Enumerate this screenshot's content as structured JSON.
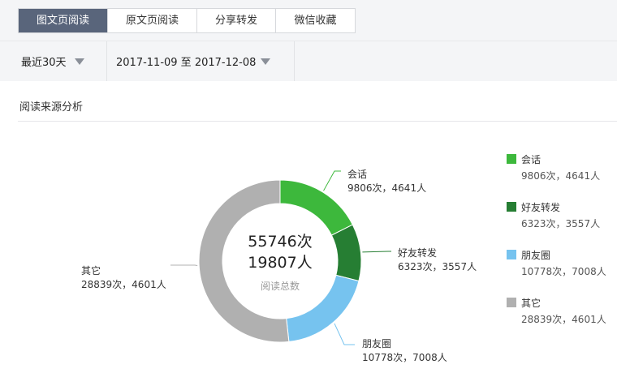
{
  "tabs": [
    {
      "label": "图文页阅读",
      "active": true
    },
    {
      "label": "原文页阅读",
      "active": false
    },
    {
      "label": "分享转发",
      "active": false
    },
    {
      "label": "微信收藏",
      "active": false
    }
  ],
  "filters": {
    "range_label": "最近30天",
    "date_range": "2017-11-09 至 2017-12-08"
  },
  "section": {
    "title": "阅读来源分析"
  },
  "chart_data": {
    "type": "pie",
    "variant": "donut",
    "legend_placement": "right",
    "center": {
      "total_times": "55746次",
      "total_people": "19807人",
      "caption": "阅读总数"
    },
    "slices": [
      {
        "name": "会话",
        "times": 9806,
        "people": 4641,
        "label": "9806次，4641人",
        "color": "#3db83c"
      },
      {
        "name": "好友转发",
        "times": 6323,
        "people": 3557,
        "label": "6323次，3557人",
        "color": "#267e33"
      },
      {
        "name": "朋友圈",
        "times": 10778,
        "people": 7008,
        "label": "10778次，7008人",
        "color": "#76c3ef"
      },
      {
        "name": "其它",
        "times": 28839,
        "people": 4601,
        "label": "28839次，4601人",
        "color": "#b0b0b0"
      }
    ]
  }
}
